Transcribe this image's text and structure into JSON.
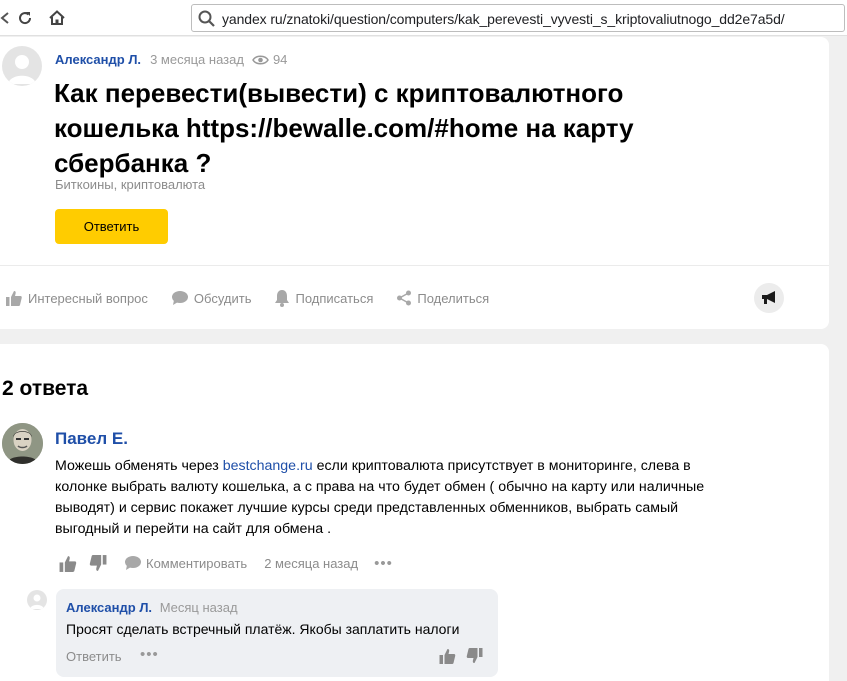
{
  "browser": {
    "url": "yandex ru/znatoki/question/computers/kak_perevesti_vyvesti_s_kriptovaliutnogo_dd2e7a5d/"
  },
  "question": {
    "author": "Александр Л.",
    "time": "3 месяца назад",
    "views": "94",
    "title": "Как перевести(вывести) с криптовалютного кошелька https://bewalle.com/#home на карту сбербанка ?",
    "tags": "Биткоины, криптовалюта",
    "answer_button": "Ответить",
    "actions": {
      "interesting": "Интересный вопрос",
      "discuss": "Обсудить",
      "subscribe": "Подписаться",
      "share": "Поделиться"
    }
  },
  "answers": {
    "count_label": "2 ответа",
    "items": [
      {
        "author": "Павел Е.",
        "text_before": "Можешь обменять через ",
        "link": "bestchange.ru",
        "text_after": " если криптовалюта присутствует в мониторинге, слева в колонке выбрать валюту кошелька, а с права на что будет обмен ( обычно на карту или наличные выводят) и сервис покажет лучшие курсы среди представленных обменников, выбрать самый выгодный и перейти на сайт для обмена .",
        "comment_label": "Комментировать",
        "time": "2 месяца назад",
        "comments": [
          {
            "author": "Александр Л.",
            "time": "Месяц назад",
            "text": "Просят сделать встречный платёж. Якобы заплатить налоги",
            "reply_label": "Ответить"
          }
        ]
      }
    ]
  },
  "colors": {
    "link": "#1f4fa8",
    "accent_button": "#ffcc00",
    "muted": "#8c8c8c"
  }
}
